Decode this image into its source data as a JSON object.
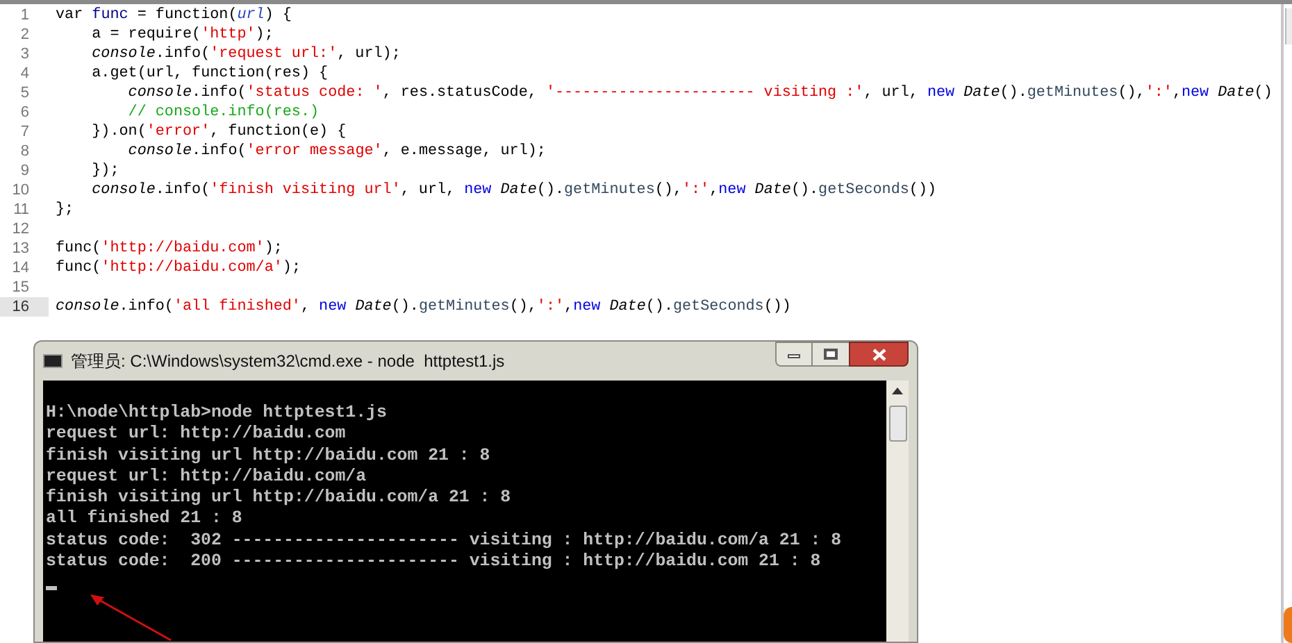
{
  "editor": {
    "lines": [
      {
        "number": "1",
        "current": false,
        "tokens": [
          {
            "kind": "plain",
            "text": "var "
          },
          {
            "kind": "name",
            "text": "func"
          },
          {
            "kind": "plain",
            "text": " = function("
          },
          {
            "kind": "param",
            "text": "url"
          },
          {
            "kind": "plain",
            "text": ") {"
          }
        ]
      },
      {
        "number": "2",
        "current": false,
        "tokens": [
          {
            "kind": "plain",
            "text": "    a = require("
          },
          {
            "kind": "string",
            "text": "'http'"
          },
          {
            "kind": "plain",
            "text": ");"
          }
        ]
      },
      {
        "number": "3",
        "current": false,
        "tokens": [
          {
            "kind": "italic",
            "text": "    console"
          },
          {
            "kind": "plain",
            "text": ".info("
          },
          {
            "kind": "string",
            "text": "'request url:'"
          },
          {
            "kind": "plain",
            "text": ", url);"
          }
        ]
      },
      {
        "number": "4",
        "current": false,
        "tokens": [
          {
            "kind": "plain",
            "text": "    a.get(url, function(res) {"
          }
        ]
      },
      {
        "number": "5",
        "current": false,
        "tokens": [
          {
            "kind": "italic",
            "text": "        console"
          },
          {
            "kind": "plain",
            "text": ".info("
          },
          {
            "kind": "string",
            "text": "'status code: '"
          },
          {
            "kind": "plain",
            "text": ", res.statusCode, "
          },
          {
            "kind": "string",
            "text": "'---------------------- visiting :'"
          },
          {
            "kind": "plain",
            "text": ", url, "
          },
          {
            "kind": "keyword",
            "text": "new"
          },
          {
            "kind": "italic",
            "text": " Date"
          },
          {
            "kind": "plain",
            "text": "()."
          },
          {
            "kind": "method",
            "text": "getMinutes"
          },
          {
            "kind": "plain",
            "text": "(),"
          },
          {
            "kind": "string",
            "text": "':'"
          },
          {
            "kind": "plain",
            "text": ","
          },
          {
            "kind": "keyword",
            "text": "new"
          },
          {
            "kind": "italic",
            "text": " Date"
          },
          {
            "kind": "plain",
            "text": "()"
          }
        ]
      },
      {
        "number": "6",
        "current": false,
        "tokens": [
          {
            "kind": "comment",
            "text": "        // console.info(res.)"
          }
        ]
      },
      {
        "number": "7",
        "current": false,
        "tokens": [
          {
            "kind": "plain",
            "text": "    }).on("
          },
          {
            "kind": "string",
            "text": "'error'"
          },
          {
            "kind": "plain",
            "text": ", function(e) {"
          }
        ]
      },
      {
        "number": "8",
        "current": false,
        "tokens": [
          {
            "kind": "italic",
            "text": "        console"
          },
          {
            "kind": "plain",
            "text": ".info("
          },
          {
            "kind": "string",
            "text": "'error message'"
          },
          {
            "kind": "plain",
            "text": ", e.message, url);"
          }
        ]
      },
      {
        "number": "9",
        "current": false,
        "tokens": [
          {
            "kind": "plain",
            "text": "    });"
          }
        ]
      },
      {
        "number": "10",
        "current": false,
        "tokens": [
          {
            "kind": "italic",
            "text": "    console"
          },
          {
            "kind": "plain",
            "text": ".info("
          },
          {
            "kind": "string",
            "text": "'finish visiting url'"
          },
          {
            "kind": "plain",
            "text": ", url, "
          },
          {
            "kind": "keyword",
            "text": "new"
          },
          {
            "kind": "italic",
            "text": " Date"
          },
          {
            "kind": "plain",
            "text": "()."
          },
          {
            "kind": "method",
            "text": "getMinutes"
          },
          {
            "kind": "plain",
            "text": "(),"
          },
          {
            "kind": "string",
            "text": "':'"
          },
          {
            "kind": "plain",
            "text": ","
          },
          {
            "kind": "keyword",
            "text": "new"
          },
          {
            "kind": "italic",
            "text": " Date"
          },
          {
            "kind": "plain",
            "text": "()."
          },
          {
            "kind": "method",
            "text": "getSeconds"
          },
          {
            "kind": "plain",
            "text": "())"
          }
        ]
      },
      {
        "number": "11",
        "current": false,
        "tokens": [
          {
            "kind": "plain",
            "text": "};"
          }
        ]
      },
      {
        "number": "12",
        "current": false
      },
      {
        "number": "13",
        "current": false,
        "tokens": [
          {
            "kind": "plain",
            "text": "func("
          },
          {
            "kind": "string",
            "text": "'http://baidu.com'"
          },
          {
            "kind": "plain",
            "text": ");"
          }
        ]
      },
      {
        "number": "14",
        "current": false,
        "tokens": [
          {
            "kind": "plain",
            "text": "func("
          },
          {
            "kind": "string",
            "text": "'http://baidu.com/a'"
          },
          {
            "kind": "plain",
            "text": ");"
          }
        ]
      },
      {
        "number": "15",
        "current": false
      },
      {
        "number": "16",
        "current": true,
        "tokens": [
          {
            "kind": "italic",
            "text": "console"
          },
          {
            "kind": "plain",
            "text": ".info("
          },
          {
            "kind": "string",
            "text": "'all finished'"
          },
          {
            "kind": "plain",
            "text": ", "
          },
          {
            "kind": "keyword",
            "text": "new"
          },
          {
            "kind": "italic",
            "text": " Date"
          },
          {
            "kind": "plain",
            "text": "()."
          },
          {
            "kind": "method",
            "text": "getMinutes"
          },
          {
            "kind": "plain",
            "text": "(),"
          },
          {
            "kind": "string",
            "text": "':'"
          },
          {
            "kind": "plain",
            "text": ","
          },
          {
            "kind": "keyword",
            "text": "new"
          },
          {
            "kind": "italic",
            "text": " Date"
          },
          {
            "kind": "plain",
            "text": "()."
          },
          {
            "kind": "method",
            "text": "getSeconds"
          },
          {
            "kind": "plain",
            "text": "())"
          }
        ]
      }
    ]
  },
  "console_window": {
    "title": "管理员: C:\\Windows\\system32\\cmd.exe - node  httptest1.js",
    "lines": [
      "H:\\node\\httplab>node httptest1.js",
      "request url: http://baidu.com",
      "finish visiting url http://baidu.com 21 : 8",
      "request url: http://baidu.com/a",
      "finish visiting url http://baidu.com/a 21 : 8",
      "all finished 21 : 8",
      "status code:  302 ---------------------- visiting : http://baidu.com/a 21 : 8",
      "status code:  200 ---------------------- visiting : http://baidu.com 21 : 8"
    ],
    "cursor": true
  }
}
